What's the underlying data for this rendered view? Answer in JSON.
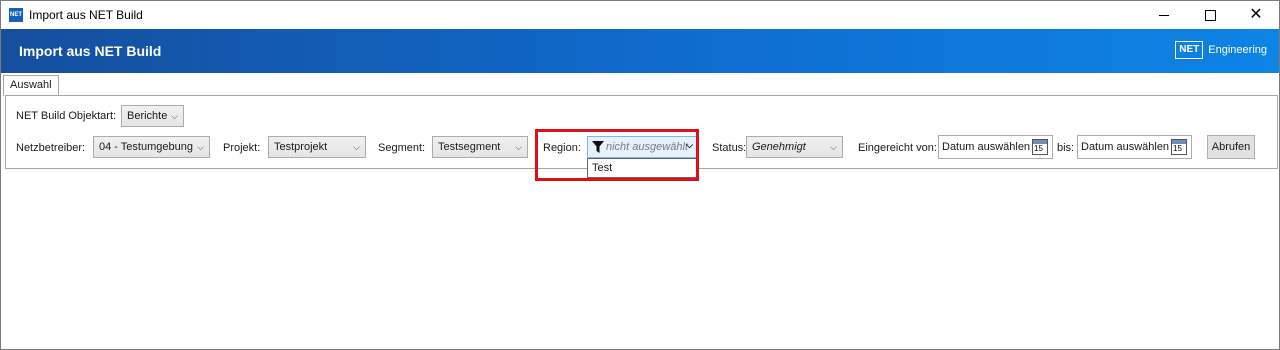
{
  "window": {
    "title": "Import aus NET Build",
    "app_icon_text": "NET"
  },
  "header": {
    "title": "Import aus NET Build",
    "brand_logo": "NET",
    "brand_text": "Engineering",
    "gradient_colors": [
      "#154e9d",
      "#0d84e6"
    ]
  },
  "tabs": [
    {
      "label": "Auswahl",
      "active": true
    }
  ],
  "form": {
    "objektart_label": "NET Build Objektart:",
    "objektart_value": "Berichte",
    "netzbetreiber_label": "Netzbetreiber:",
    "netzbetreiber_value": "04 - Testumgebung",
    "projekt_label": "Projekt:",
    "projekt_value": "Testprojekt",
    "segment_label": "Segment:",
    "segment_value": "Testsegment",
    "region_label": "Region:",
    "region_placeholder": "nicht ausgewählt",
    "region_options": [
      "Test"
    ],
    "status_label": "Status:",
    "status_value": "Genehmigt",
    "eingereicht_label": "Eingereicht von:",
    "date_from_placeholder": "Datum auswählen",
    "bis_label": "bis:",
    "date_to_placeholder": "Datum auswählen",
    "calendar_day": "15",
    "abrufen_label": "Abrufen"
  },
  "highlight_color": "#e0101a"
}
